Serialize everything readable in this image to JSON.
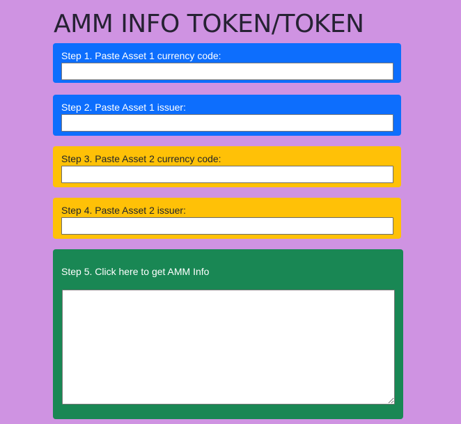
{
  "page": {
    "title": "AMM INFO TOKEN/TOKEN"
  },
  "steps": [
    {
      "label": "Step 1. Paste Asset 1 currency code:",
      "value": "",
      "placeholder": "",
      "color": "#0d6efd"
    },
    {
      "label": "Step 2. Paste Asset 1 issuer:",
      "value": "",
      "placeholder": "",
      "color": "#0d6efd"
    },
    {
      "label": "Step 3. Paste Asset 2 currency code:",
      "value": "",
      "placeholder": "",
      "color": "#ffc107"
    },
    {
      "label": "Step 4. Paste Asset 2 issuer:",
      "value": "",
      "placeholder": "",
      "color": "#ffc107"
    }
  ],
  "action": {
    "label": "Step 5. Click here to get AMM Info",
    "color": "#198754",
    "result_value": ""
  },
  "colors": {
    "background": "#cf93e2",
    "title_text": "#262233"
  }
}
